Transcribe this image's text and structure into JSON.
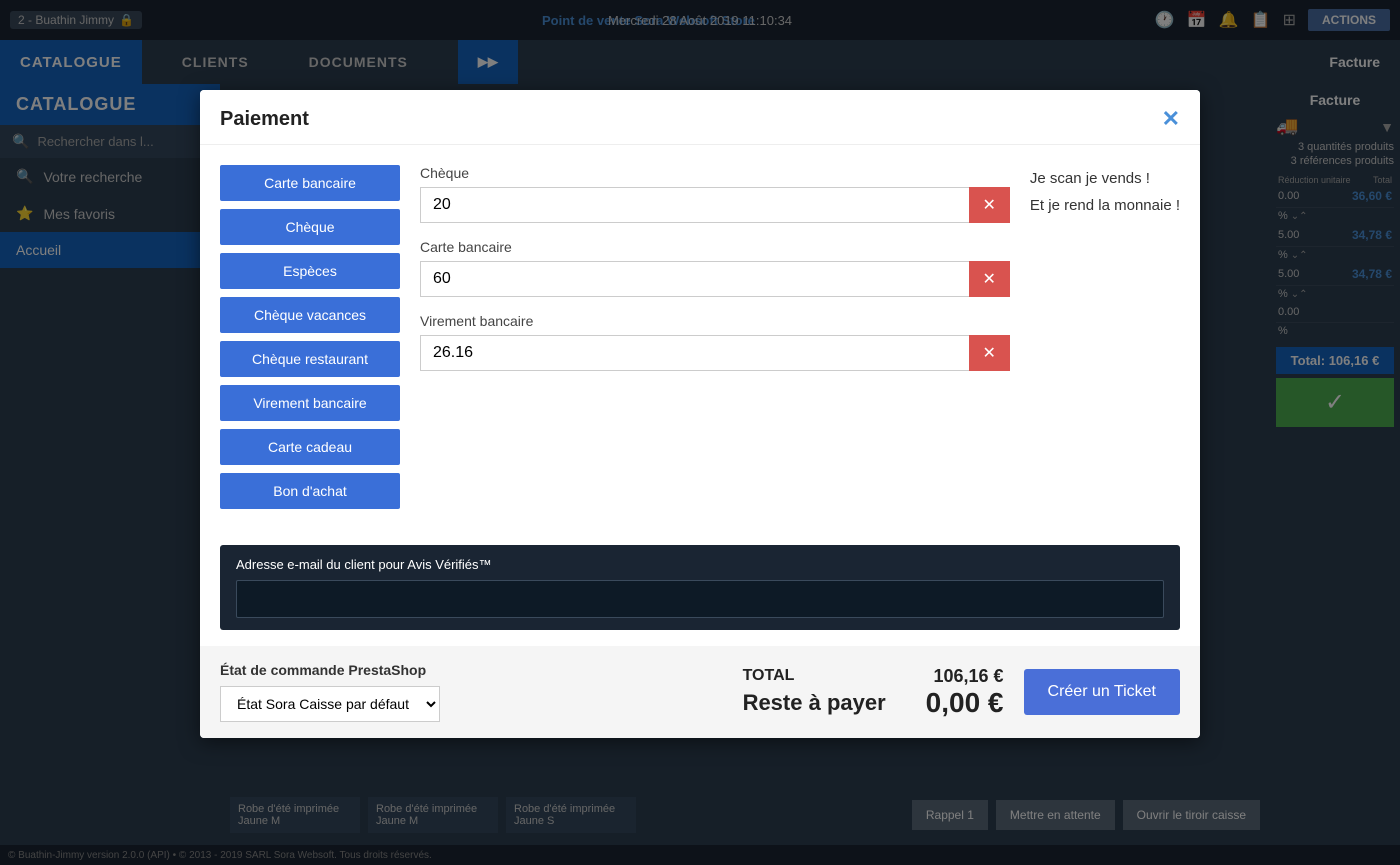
{
  "topbar": {
    "datetime": "Mercredi 28 Août 2019 11:10:34",
    "pos_label": "Point de vente",
    "store_name": "Sora Websoft Store",
    "user": "2 - Buathin Jimmy",
    "actions_label": "ACTIONS"
  },
  "nav": {
    "catalogue": "CATALOGUE",
    "clients": "CLIENTS",
    "documents": "DOCUMENTS",
    "facture": "Facture"
  },
  "sidebar": {
    "catalogue_label": "CATALOGUE",
    "search_placeholder": "Rechercher dans l...",
    "votre_recherche": "Votre recherche",
    "mes_favoris": "Mes favoris",
    "accueil": "Accueil"
  },
  "right_panel": {
    "facture": "Facture",
    "quantities": "3  quantités produits",
    "references": "3  références produits",
    "reduction_label": "Réduction unitaire",
    "total_label": "Total",
    "rows": [
      {
        "reduction": "0.00",
        "percent": "%",
        "total": "36,60 €"
      },
      {
        "reduction": "5.00",
        "percent": "%",
        "total": "34,78 €"
      },
      {
        "reduction": "5.00",
        "percent": "%",
        "total": "34,78 €"
      },
      {
        "reduction": "0.00",
        "percent": "%",
        "total": ""
      }
    ],
    "total_bar": "Total:  106,16 €",
    "check_icon": "✓"
  },
  "modal": {
    "title": "Paiement",
    "close_icon": "✕",
    "payment_methods": [
      {
        "label": "Carte bancaire",
        "id": "carte-bancaire"
      },
      {
        "label": "Chèque",
        "id": "cheque"
      },
      {
        "label": "Espèces",
        "id": "especes"
      },
      {
        "label": "Chèque vacances",
        "id": "cheque-vacances"
      },
      {
        "label": "Chèque restaurant",
        "id": "cheque-restaurant"
      },
      {
        "label": "Virement bancaire",
        "id": "virement-bancaire"
      },
      {
        "label": "Carte cadeau",
        "id": "carte-cadeau"
      },
      {
        "label": "Bon d'achat",
        "id": "bon-achat"
      }
    ],
    "fields": [
      {
        "label": "Chèque",
        "value": "20"
      },
      {
        "label": "Carte bancaire",
        "value": "60"
      },
      {
        "label": "Virement bancaire",
        "value": "26.16"
      }
    ],
    "message_line1": "Je scan je vends !",
    "message_line2": "Et je rend la monnaie !",
    "email_label": "Adresse e-mail du client pour Avis Vérifiés™",
    "email_value": "",
    "order_state_label": "État de commande PrestaShop",
    "order_state_value": "État Sora Caisse par défaut",
    "total_label": "TOTAL",
    "total_value": "106,16 €",
    "reste_label": "Reste à payer",
    "reste_value": "0,00 €",
    "btn_ticket": "Créer un Ticket"
  },
  "bottom": {
    "products": [
      {
        "name": "Robe d'été imprimée Jaune M"
      },
      {
        "name": "Robe d'été imprimée Jaune M"
      },
      {
        "name": "Robe d'été imprimée Jaune S"
      }
    ],
    "btn_recall": "Rappel 1",
    "btn_hold": "Mettre en attente",
    "btn_drawer": "Ouvrir le tiroir caisse"
  },
  "footer": {
    "text": "© Buathin-Jimmy version 2.0.0 (API) • © 2013 - 2019 SARL Sora Websoft. Tous droits réservés."
  }
}
